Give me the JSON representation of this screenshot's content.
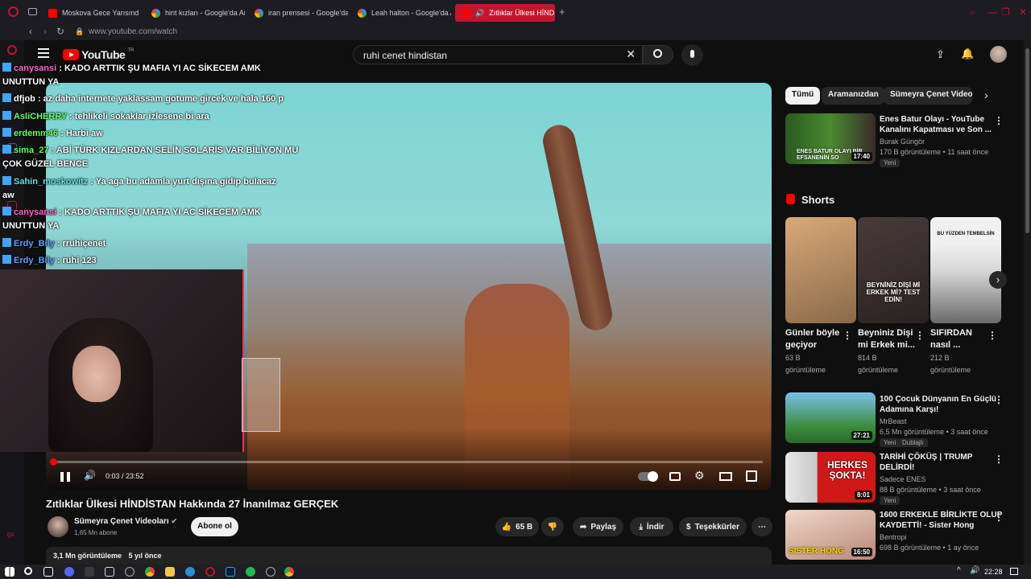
{
  "browser": {
    "tabs": [
      {
        "label": "Moskova Gece Yarısınd"
      },
      {
        "label": "hint kızları - Google'da Ar"
      },
      {
        "label": "iran prensesi - Google'da"
      },
      {
        "label": "Leah halton - Google'da A"
      },
      {
        "label": "Zıtlıklar Ülkesi HİNDİS"
      }
    ],
    "url": "www.youtube.com/watch"
  },
  "youtube": {
    "logo": "YouTube",
    "region": "TR",
    "search_value": "ruhi cenet hindistan"
  },
  "chat": [
    {
      "user": "canysansi",
      "msg": " : KADO ARTTIK ŞU MAFIA YI AC SİKECEM AMK",
      "user_color": "#ff66cc"
    },
    {
      "user": "",
      "msg": "UNUTTUN YA",
      "user_color": "#ffffff"
    },
    {
      "user": "dfjob",
      "msg": " : az daha internete yaklassam gotume gircek ve hala 160 p",
      "user_color": "#ffffff"
    },
    {
      "user": "AsliCHERRY",
      "msg": " : tehlikeli sokaklar izlesene bi ara",
      "user_color": "#66ff66"
    },
    {
      "user": "erdemm46",
      "msg": " : Harbi aw",
      "user_color": "#66ff66"
    },
    {
      "user": "sima_27",
      "msg": " : ABİ TÜRK KIZLARDAN SELİN SOLARİS VAR BİLİYON MU",
      "user_color": "#66ff66"
    },
    {
      "user": "",
      "msg": "ÇOK GÜZEL BENCE",
      "user_color": "#ffffff"
    },
    {
      "user": "Sahin_moskowitz",
      "msg": " : Ya aga bu adamla yurt dışına gidip bulacaz",
      "user_color": "#66e0e0"
    },
    {
      "user": "",
      "msg": "aw",
      "user_color": "#ffffff"
    },
    {
      "user": "canysansi",
      "msg": " : KADO ARTTIK ŞU MAFIA YI AC SİKECEM AMK",
      "user_color": "#ff66cc"
    },
    {
      "user": "",
      "msg": "UNUTTUN YA",
      "user_color": "#ffffff"
    },
    {
      "user": "Erdy_Bily",
      "msg": " : rruhiçenet",
      "user_color": "#5aa0ff"
    },
    {
      "user": "Erdy_Bily",
      "msg": " : ruhi 123",
      "user_color": "#5aa0ff"
    }
  ],
  "player": {
    "time": "0:03 / 23:52",
    "progress": 0.002
  },
  "video": {
    "title": "Zıtlıklar Ülkesi HİNDİSTAN Hakkında 27 İnanılmaz GERÇEK",
    "channel": "Sümeyra Çenet Videoları",
    "subscribers": "1,65 Mn abone",
    "subscribe_label": "Abone ol",
    "likes": "65 B",
    "share_label": "Paylaş",
    "download_label": "İndir",
    "thanks_label": "Teşekkürler",
    "views": "3,1 Mn görüntüleme",
    "age": "5 yıl önce"
  },
  "chips": [
    "Tümü",
    "Aramanızdan",
    "Sümeyra Çenet Videoları"
  ],
  "recommendations": [
    {
      "title1": "Enes Batur Olayı - YouTube",
      "title2": "Kanalını Kapatması ve Son ...",
      "channel": "Burak Güngör",
      "meta": "170 B görüntüleme • 11 saat önce",
      "badge": "Yeni",
      "duration": "17:40",
      "thumb_text": "ENES BATUR OLAYI BİR EFSANENİN SO"
    },
    {
      "title1": "100 Çocuk Dünyanın En Güçlü",
      "title2": "Adamına Karşı!",
      "channel": "MrBeast",
      "meta": "6,5 Mn görüntüleme • 3 saat önce",
      "badge": "Yeni",
      "badge2": "Dublajlı",
      "duration": "27:21"
    },
    {
      "title1": "TARİHİ ÇÖKÜŞ | TRUMP",
      "title2": "DELİRDİ!",
      "channel": "Sadece ENES",
      "meta": "88 B görüntüleme • 3 saat önce",
      "badge": "Yeni",
      "duration": "8:01",
      "thumb_text": "HERKES ŞOKTA!"
    },
    {
      "title1": "1600 ERKEKLE BİRLİKTE OLUP",
      "title2": "KAYDETTİ! - Sister Hong",
      "channel": "Bentropi",
      "meta": "698 B görüntüleme • 1 ay önce",
      "duration": "16:50",
      "thumb_text": "SISTER HONG"
    }
  ],
  "shorts": {
    "heading": "Shorts",
    "items": [
      {
        "title1": "Günler böyle",
        "title2": "geçiyor",
        "views": "63 B",
        "views_label": "görüntüleme"
      },
      {
        "title1": "Beyniniz Dişi",
        "title2": "mi Erkek mi...",
        "views": "814 B",
        "views_label": "görüntüleme",
        "thumb_text": "BEYNİNİZ DİŞİ Mİ ERKEK Mİ? TEST EDİN!"
      },
      {
        "title1": "SIFIRDAN",
        "title2": "nasıl ...",
        "views": "212 B",
        "views_label": "görüntüleme",
        "thumb_text": "BU YÜZDEN TEMBELSİN"
      }
    ]
  },
  "taskbar": {
    "time": "22:28"
  },
  "colors": {
    "accent": "#c4152f",
    "youtube_red": "#ff0000",
    "bg": "#0f0f0f"
  }
}
